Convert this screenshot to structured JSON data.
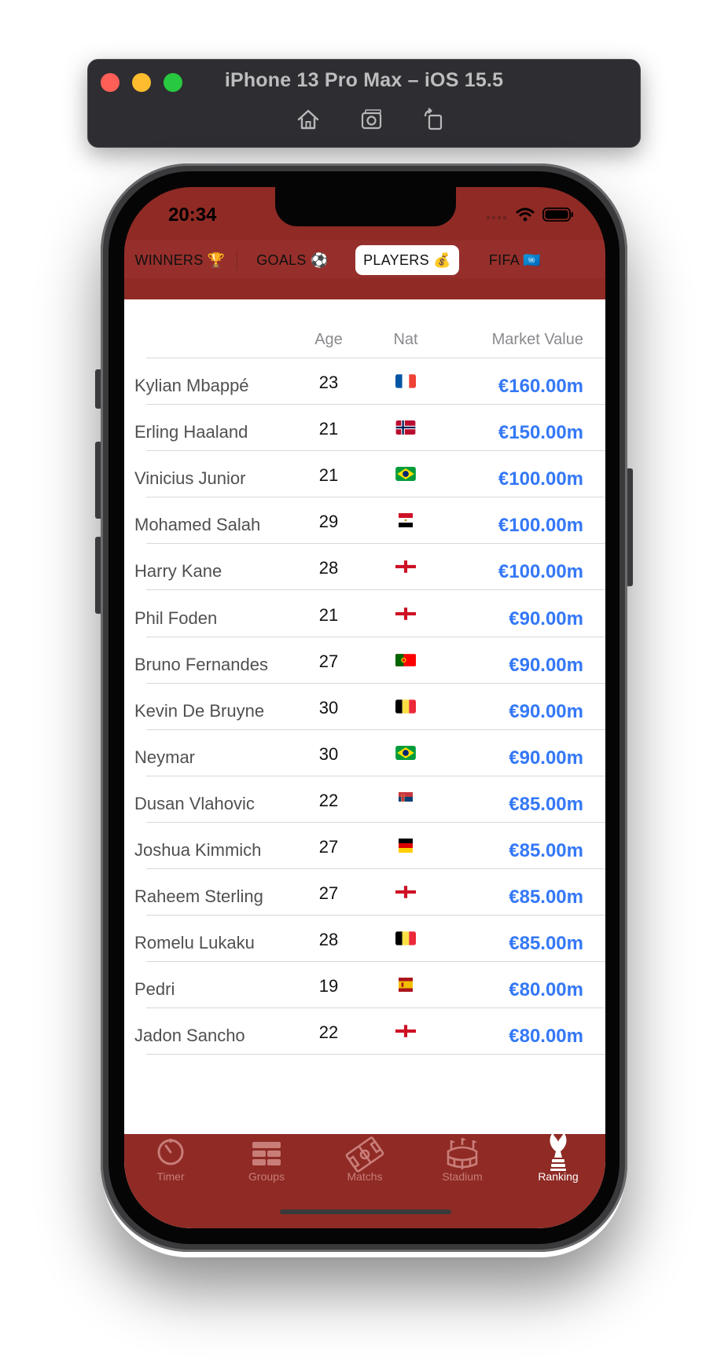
{
  "simulator": {
    "title": "iPhone 13 Pro Max – iOS 15.5",
    "tools": [
      "home-icon",
      "screenshot-icon",
      "rotate-icon"
    ]
  },
  "status_bar": {
    "time": "20:34"
  },
  "segments": [
    {
      "label": "WINNERS 🏆"
    },
    {
      "label": "GOALS ⚽"
    },
    {
      "label": "PLAYERS 💰"
    },
    {
      "label": "FIFA 🇺🇳"
    }
  ],
  "selected_segment": "PLAYERS 💰",
  "table": {
    "headers": {
      "age": "Age",
      "nat": "Nat",
      "value": "Market Value"
    },
    "rows": [
      {
        "name": "Kylian Mbappé",
        "age": "23",
        "nat": "France",
        "value": "€160.00m"
      },
      {
        "name": "Erling Haaland",
        "age": "21",
        "nat": "Norway",
        "value": "€150.00m"
      },
      {
        "name": "Vinicius Junior",
        "age": "21",
        "nat": "Brazil",
        "value": "€100.00m"
      },
      {
        "name": "Mohamed Salah",
        "age": "29",
        "nat": "Egypt",
        "value": "€100.00m"
      },
      {
        "name": "Harry Kane",
        "age": "28",
        "nat": "England",
        "value": "€100.00m"
      },
      {
        "name": "Phil Foden",
        "age": "21",
        "nat": "England",
        "value": "€90.00m"
      },
      {
        "name": "Bruno Fernandes",
        "age": "27",
        "nat": "Portugal",
        "value": "€90.00m"
      },
      {
        "name": "Kevin De Bruyne",
        "age": "30",
        "nat": "Belgium",
        "value": "€90.00m"
      },
      {
        "name": "Neymar",
        "age": "30",
        "nat": "Brazil",
        "value": "€90.00m"
      },
      {
        "name": "Dusan Vlahovic",
        "age": "22",
        "nat": "Serbia",
        "value": "€85.00m"
      },
      {
        "name": "Joshua Kimmich",
        "age": "27",
        "nat": "Germany",
        "value": "€85.00m"
      },
      {
        "name": "Raheem Sterling",
        "age": "27",
        "nat": "England",
        "value": "€85.00m"
      },
      {
        "name": "Romelu Lukaku",
        "age": "28",
        "nat": "Belgium",
        "value": "€85.00m"
      },
      {
        "name": "Pedri",
        "age": "19",
        "nat": "Spain",
        "value": "€80.00m"
      },
      {
        "name": "Jadon Sancho",
        "age": "22",
        "nat": "England",
        "value": "€80.00m"
      }
    ]
  },
  "tab_bar": {
    "items": [
      {
        "label": "Timer",
        "icon": "timer-icon"
      },
      {
        "label": "Groups",
        "icon": "groups-icon"
      },
      {
        "label": "Matchs",
        "icon": "pitch-icon"
      },
      {
        "label": "Stadium",
        "icon": "stadium-icon"
      },
      {
        "label": "Ranking",
        "icon": "trophy-icon"
      }
    ],
    "selected": "Ranking"
  },
  "colors": {
    "brand_red": "#8f2a25",
    "value_blue": "#3478f6",
    "tab_inactive": "#c97d78",
    "tab_active": "#ffffff"
  }
}
